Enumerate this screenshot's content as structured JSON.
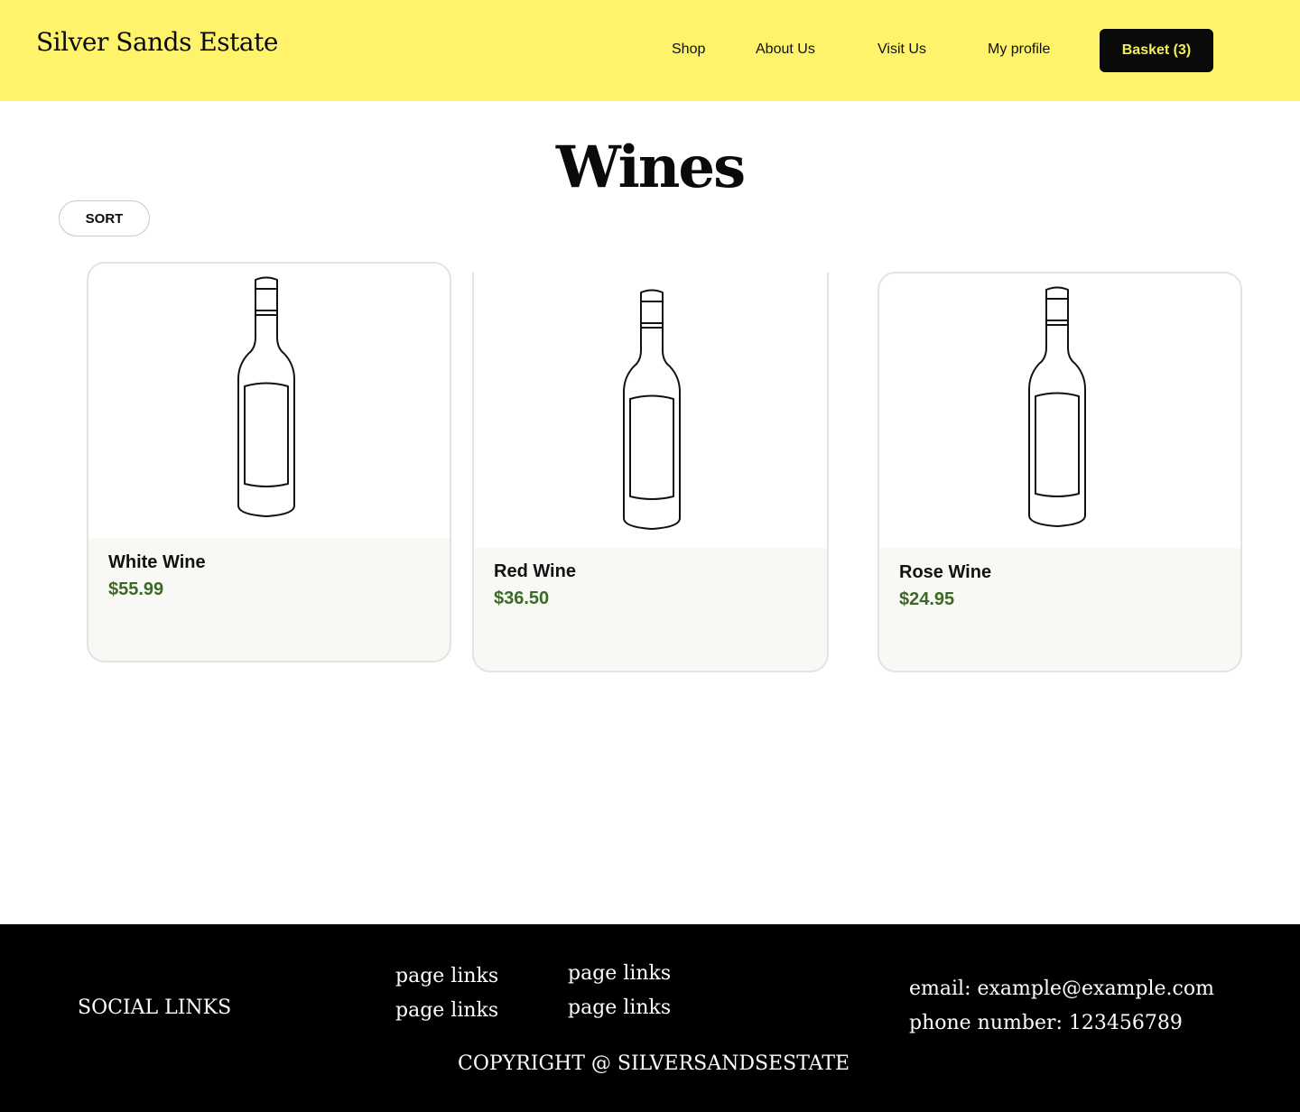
{
  "header": {
    "brand": "Silver Sands Estate",
    "nav": [
      "Shop",
      "About Us",
      "Visit Us",
      "My profile"
    ],
    "basket_label": "Basket (3)"
  },
  "main": {
    "title": "Wines",
    "sort_label": "SORT",
    "products": [
      {
        "name": "White Wine",
        "price": "$55.99",
        "icon": "wine-bottle-icon"
      },
      {
        "name": "Red Wine",
        "price": "$36.50",
        "icon": "wine-bottle-icon"
      },
      {
        "name": "Rose Wine",
        "price": "$24.95",
        "icon": "wine-bottle-icon"
      }
    ]
  },
  "footer": {
    "social": "SOCIAL LINKS",
    "page_links": [
      "page links",
      "page links",
      "page links",
      "page links"
    ],
    "email": "email: example@example.com",
    "phone": "phone number: 123456789",
    "copyright": "COPYRIGHT @ SILVERSANDSESTATE"
  },
  "colors": {
    "header_bg": "#fff36b",
    "basket_bg": "#0a0a0a",
    "basket_text": "#f6ee55",
    "price": "#3c6a24",
    "footer_bg": "#000000"
  }
}
